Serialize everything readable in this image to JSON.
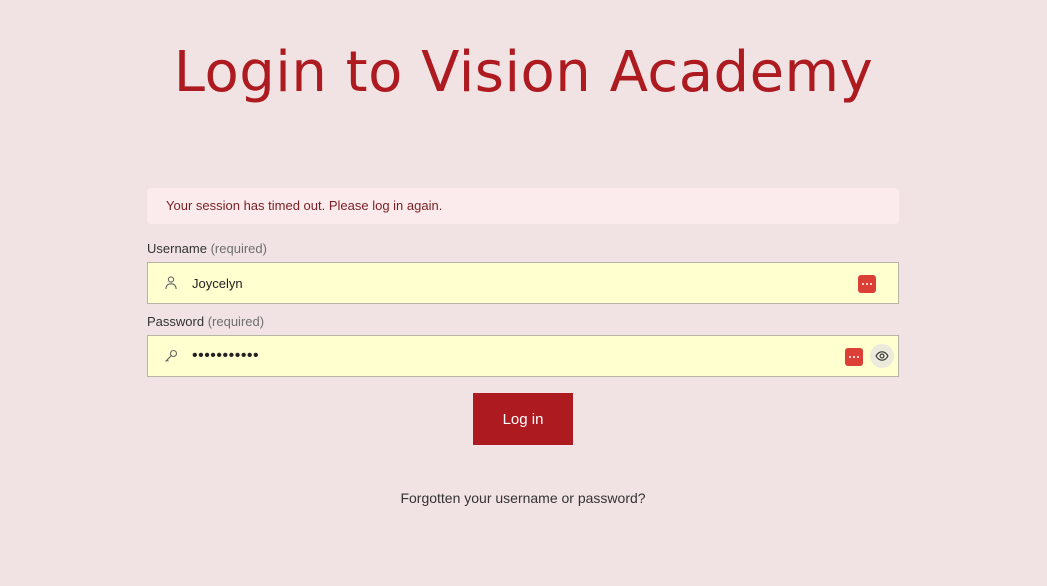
{
  "page": {
    "title": "Login to Vision Academy"
  },
  "alert": {
    "message": "Your session has timed out. Please log in again."
  },
  "username": {
    "label": "Username",
    "required": "(required)",
    "value": "Joycelyn",
    "icon": "user-icon"
  },
  "password": {
    "label": "Password",
    "required": "(required)",
    "value": "•••••••••••",
    "icon": "key-icon",
    "toggle_icon": "eye-icon"
  },
  "actions": {
    "login_label": "Log in",
    "forgot_link": "Forgotten your username or password?"
  },
  "colors": {
    "background": "#f1e2e3",
    "accent": "#ad1a20",
    "alert_bg": "#fcebed",
    "field_bg": "#ffffcf",
    "password_manager": "#dc3f36"
  }
}
